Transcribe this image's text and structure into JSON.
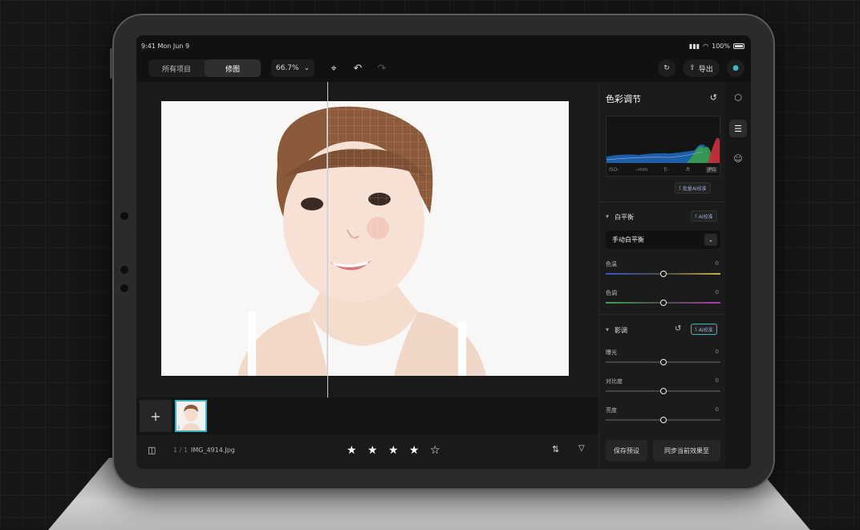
{
  "status": {
    "time": "9:41  Mon Jun 9",
    "battery": "100%"
  },
  "toolbar": {
    "tabs": [
      {
        "label": "所有项目"
      },
      {
        "label": "修图"
      }
    ],
    "zoom": "66.7%",
    "export_label": "导出"
  },
  "filmstrip": {
    "thumb_index": "1"
  },
  "bottombar": {
    "page": "1 / 1",
    "filename": "IMG_4914.Jpg",
    "rating": 4,
    "rating_max": 5
  },
  "panel": {
    "title": "色彩调节",
    "hist_labels": [
      "ISO-",
      "--mm",
      "f/-",
      "-ft",
      "JPG"
    ],
    "batch_ai_label": "批量AI校准",
    "white_balance": {
      "title": "白平衡",
      "ai_label": "AI校准",
      "mode": "手动白平衡",
      "sliders": [
        {
          "label": "色温",
          "value": "0",
          "position": 0.5
        },
        {
          "label": "色调",
          "value": "0",
          "position": 0.5
        }
      ]
    },
    "tone": {
      "title": "影调",
      "ai_label": "AI校准",
      "sliders": [
        {
          "label": "曝光",
          "value": "0",
          "position": 0.5
        },
        {
          "label": "对比度",
          "value": "0",
          "position": 0.5
        },
        {
          "label": "亮度",
          "value": "0",
          "position": 0.5
        }
      ]
    },
    "save_preset": "保存预设",
    "sync_effect": "同步当前效果至"
  },
  "colors": {
    "accent": "#3bb6c4",
    "bg": "#111111"
  }
}
